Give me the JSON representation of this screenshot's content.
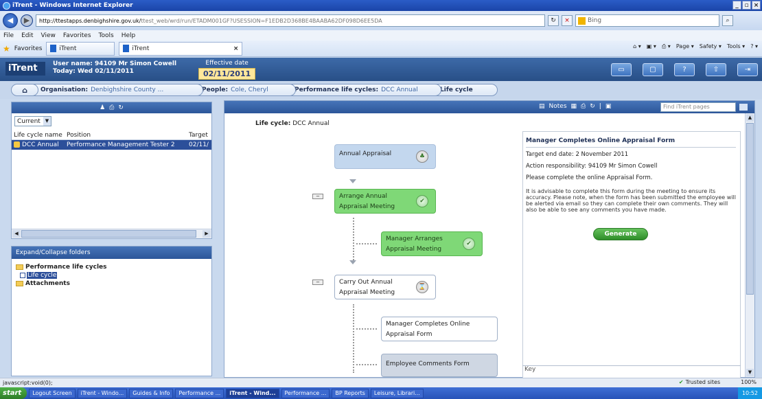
{
  "browser": {
    "title": "iTrent - Windows Internet Explorer",
    "url_host": "http://ttestapps.denbighshire.gov.uk/",
    "url_rest": "ttest_web/wrd/run/ETADM001GF?USESSION=F1EDB2D368BE4BAABA62DF098D6EE5DA",
    "search_text": "Bing",
    "menu": [
      "File",
      "Edit",
      "View",
      "Favorites",
      "Tools",
      "Help"
    ],
    "favorites_label": "Favorites",
    "tabs": [
      "iTrent",
      "iTrent"
    ],
    "commands": [
      "Page ▾",
      "Safety ▾",
      "Tools ▾"
    ]
  },
  "header": {
    "logo": "iTrent",
    "user_name": "User name: 94109 Mr Simon Cowell",
    "today": "Today: Wed 02/11/2011",
    "effective_label": "Effective date",
    "effective_date": "02/11/2011"
  },
  "breadcrumb": {
    "org_label": "Organisation:",
    "org_value": "Denbighshire County ...",
    "people_label": "People:",
    "people_value": "Cole, Cheryl",
    "cycles_label": "Performance life cycles:",
    "cycles_value": "DCC Annual",
    "lifecycle_label": "Life cycle"
  },
  "left": {
    "filter": "Current",
    "columns": [
      "Life cycle name",
      "Position",
      "Target"
    ],
    "row": [
      "DCC Annual",
      "Performance Management Tester 2",
      "02/11/"
    ],
    "expand_label": "Expand/Collapse folders",
    "tree": {
      "folder1": "Performance life cycles",
      "child1": "Life cycle",
      "folder2": "Attachments"
    }
  },
  "main": {
    "notes_label": "Notes",
    "find_placeholder": "Find iTrent pages",
    "lifecycle_label": "Life cycle:",
    "lifecycle_value": "DCC Annual",
    "nodes": {
      "annual": "Annual Appraisal",
      "arrange_1": "Arrange Annual",
      "arrange_2": "Appraisal Meeting",
      "mgr_arranges_1": "Manager Arranges",
      "mgr_arranges_2": "Appraisal Meeting",
      "carry_1": "Carry Out Annual",
      "carry_2": "Appraisal Meeting",
      "mgr_completes_1": "Manager Completes Online",
      "mgr_completes_2": "Appraisal Form",
      "employee": "Employee Comments Form"
    },
    "detail": {
      "title": "Manager Completes Online Appraisal Form",
      "target": "Target end date: 2 November 2011",
      "responsibility": "Action responsibility: 94109 Mr Simon Cowell",
      "instruction": "Please complete the online Appraisal Form.",
      "advice": "It is advisable to complete this form during the meeting to ensure its accuracy. Please note, when the form has been submitted the employee will be alerted via email so they can complete their own comments. They will also be able to see any comments you have made.",
      "generate": "Generate",
      "key_label": "Key"
    }
  },
  "status": {
    "left": "javascript:void(0);",
    "zone": "Trusted sites",
    "zoom": "100%"
  },
  "taskbar": {
    "start": "start",
    "items": [
      "Logout Screen",
      "iTrent - Windo...",
      "Guides & Info",
      "Performance ...",
      "iTrent - Wind...",
      "Performance ...",
      "BP Reports",
      "Leisure, Librari..."
    ],
    "clock": "10:52"
  }
}
